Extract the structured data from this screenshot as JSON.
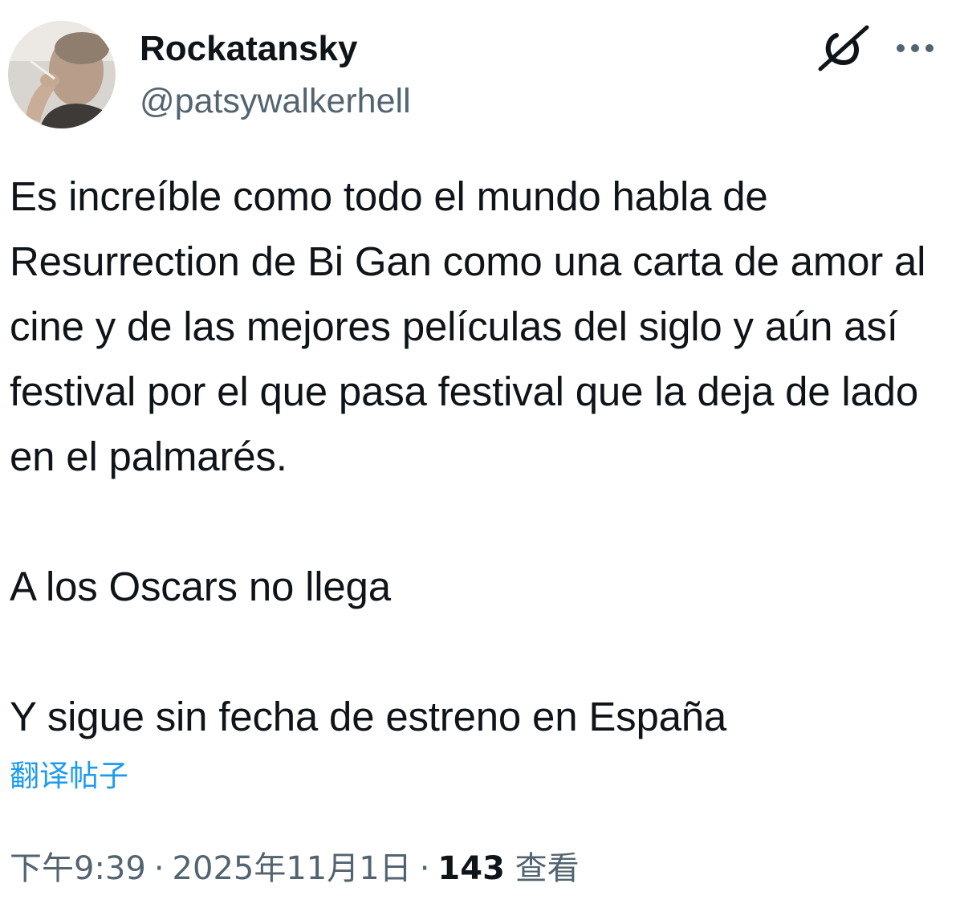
{
  "author": {
    "display_name": "Rockatansky",
    "handle": "@patsywalkerhell",
    "avatar_icon": "profile-photo"
  },
  "header_icons": {
    "grok": "grok-icon",
    "more": "more-icon"
  },
  "tweet": {
    "paragraph_1": "Es increíble como todo el mundo habla de Resurrection de Bi Gan como una carta de amor al cine y de las mejores películas del siglo y aún así festival por el que pasa festival que la deja de lado en el palmarés.",
    "paragraph_2": "A los Oscars no llega",
    "paragraph_3": "Y sigue sin fecha de estreno en España"
  },
  "translate_label": "翻译帖子",
  "meta": {
    "time": "下午9:39",
    "separator": "·",
    "date": "2025年11月1日",
    "views_count": "143",
    "views_label": "查看"
  },
  "colors": {
    "text": "#0f1419",
    "secondary": "#536471",
    "link": "#1d9bf0"
  }
}
